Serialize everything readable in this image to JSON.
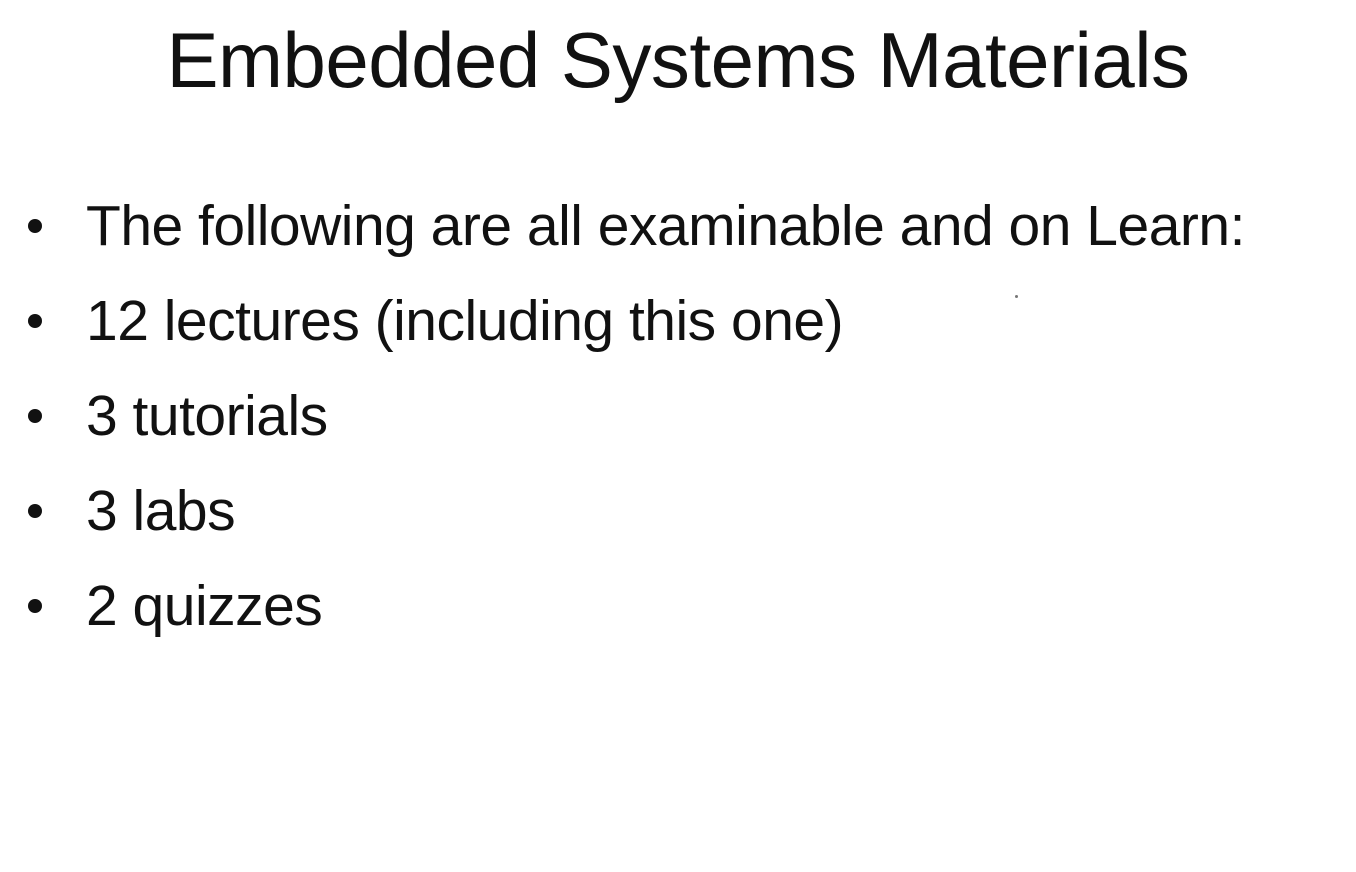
{
  "slide": {
    "title": "Embedded Systems Materials",
    "bullets": [
      "The following are all examinable and on Learn:",
      "12 lectures (including this one)",
      "3 tutorials",
      "3 labs",
      "2 quizzes"
    ]
  }
}
